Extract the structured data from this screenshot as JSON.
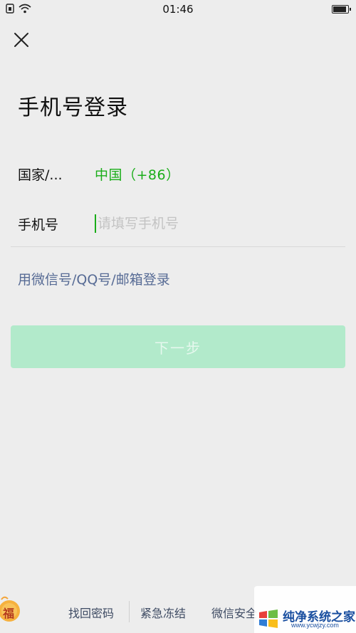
{
  "status_bar": {
    "time": "01:46"
  },
  "header": {
    "title": "手机号登录"
  },
  "form": {
    "country_label": "国家/...",
    "country_value": "中国（+86）",
    "phone_label": "手机号",
    "phone_placeholder": "请填写手机号",
    "phone_value": ""
  },
  "alt_login_label": "用微信号/QQ号/邮箱登录",
  "next_button_label": "下一步",
  "footer": {
    "links": [
      "找回密码",
      "紧急冻结",
      "微信安全"
    ]
  },
  "badge": {
    "text": "福"
  },
  "watermark": {
    "name": "纯净系统之家",
    "url": "www.ycwjzy.com"
  },
  "colors": {
    "accent_green": "#1AAD19",
    "link_blue": "#576B95",
    "disabled_button": "#B2EACB",
    "background": "#EDEDED"
  },
  "icons": {
    "close": "close-icon",
    "wifi": "wifi-icon",
    "sim": "sim-card-icon",
    "battery": "battery-icon"
  }
}
